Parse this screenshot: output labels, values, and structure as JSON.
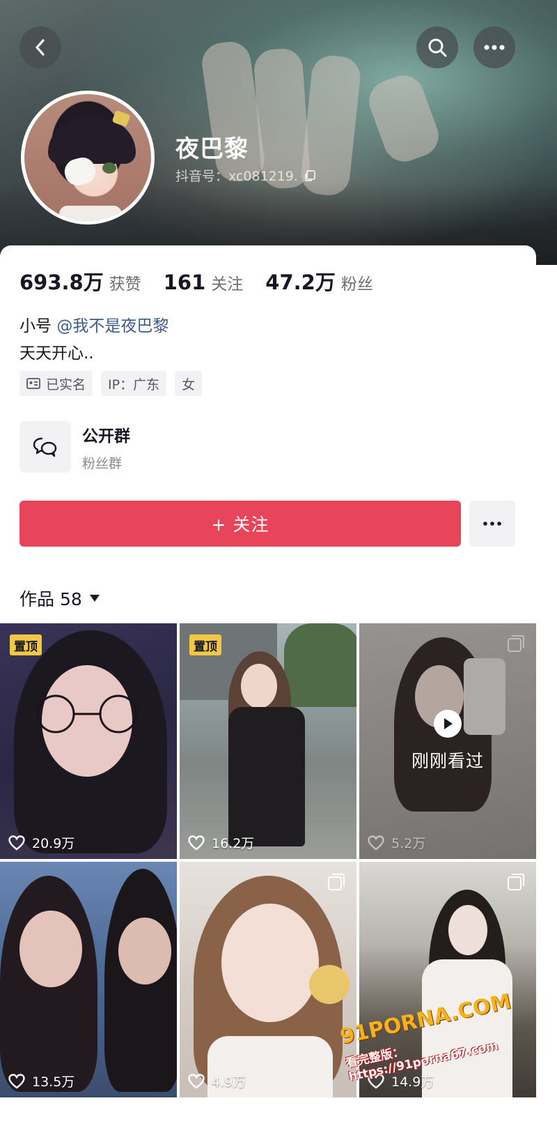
{
  "profile": {
    "nickname": "夜巴黎",
    "douyin_id": "抖音号：xc081219.",
    "stats": [
      {
        "value": "693.8万",
        "label": "获赞"
      },
      {
        "value": "161",
        "label": "关注"
      },
      {
        "value": "47.2万",
        "label": "粉丝"
      }
    ],
    "bio_prefix": "小号",
    "bio_mention": "@我不是夜巴黎",
    "bio_line2": "天天开心..",
    "tags": {
      "verified": "已实名",
      "ip": "IP：广东",
      "gender": "女"
    }
  },
  "group": {
    "title": "公开群",
    "subtitle": "粉丝群"
  },
  "actions": {
    "follow_label": "+ 关注"
  },
  "works": {
    "label": "作品 58"
  },
  "videos": [
    {
      "pinned": "置顶",
      "likes": "20.9万"
    },
    {
      "pinned": "置顶",
      "likes": "16.2万"
    },
    {
      "status": "刚刚看过",
      "likes": "5.2万"
    },
    {
      "likes": "13.5万"
    },
    {
      "likes": "4.9万"
    },
    {
      "likes": "14.9万"
    }
  ],
  "watermark": {
    "logo": "91PORNA.COM",
    "url": "看完整版：https://91porna67.com"
  },
  "icons": {
    "back": "back-arrow-icon",
    "search": "search-icon",
    "more": "more-dots-icon",
    "copy": "copy-icon",
    "id_card": "id-card-icon",
    "chat": "chat-bubbles-icon",
    "heart": "heart-icon",
    "play": "play-icon",
    "dropdown": "triangle-down-icon"
  },
  "colors": {
    "follow": "#e8445a",
    "mention": "#3f5a86",
    "pin": "#f2c745"
  }
}
